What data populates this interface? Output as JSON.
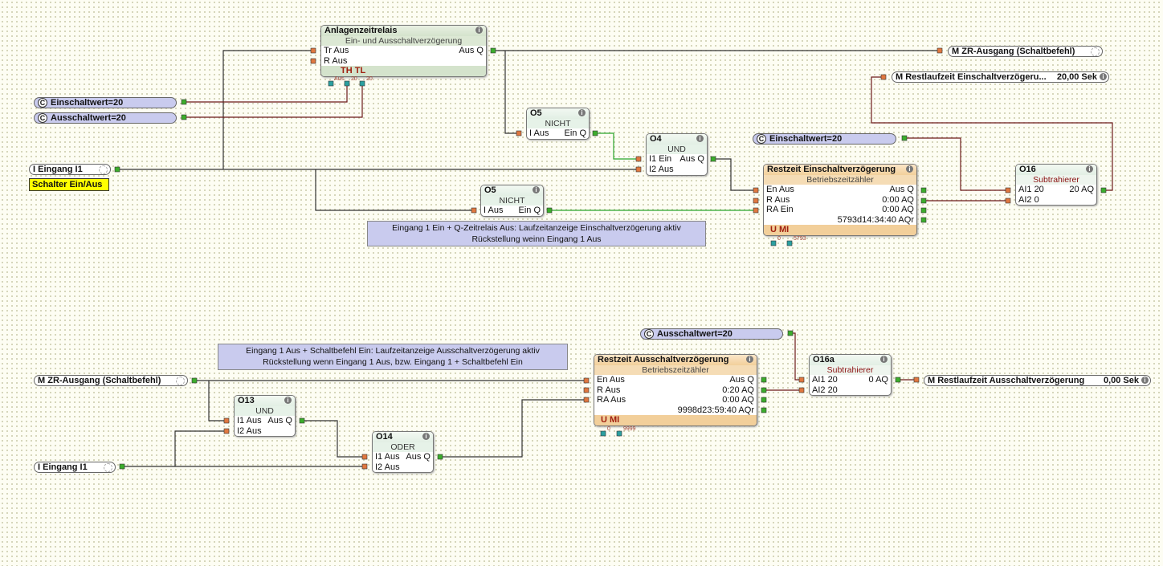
{
  "relay": {
    "title": "Anlagenzeitrelais",
    "subtitle": "Ein- und Ausschaltverzögerung",
    "in1": "Tr Aus",
    "in2": "R Aus",
    "out": "Aus Q",
    "footer": "TH  TL",
    "p1": "Aus",
    "p2": "20",
    "p3": "20"
  },
  "o5a": {
    "title": "O5",
    "subtitle": "NICHT",
    "in": "I Aus",
    "out": "Ein Q"
  },
  "o4": {
    "title": "O4",
    "subtitle": "UND",
    "in1": "I1 Ein",
    "out": "Aus Q",
    "in2": "I2 Aus"
  },
  "o5b": {
    "title": "O5",
    "subtitle": "NICHT",
    "in": "I Aus",
    "out": "Ein Q"
  },
  "rein": {
    "title": "Restzeit Einschaltverzögerung",
    "subtitle": "Betriebszeitzähler",
    "in1": "En Aus",
    "in2": "R Aus",
    "in3": "RA Ein",
    "out1": "Aus Q",
    "out2": "0:00 AQ",
    "out3": "0:00 AQ",
    "out4": "5793d14:34:40 AQr",
    "footer": "U  MI",
    "p1": "0",
    "p2": "5793"
  },
  "o16": {
    "title": "O16",
    "subtitle": "Subtrahierer",
    "in1": "AI1 20",
    "out": "20 AQ",
    "in2": "AI2 0"
  },
  "comment1": [
    "Eingang 1 Ein + Q-Zeitrelais Aus: Laufzeitanzeige Einschaltverzögerung aktiv",
    "Rückstellung weinn Eingang 1 Aus"
  ],
  "const_ein_top": "Einschaltwert=20",
  "const_ein": "Einschaltwert=20",
  "const_aus": "Ausschaltwert=20",
  "const_aus_bottom": "Ausschaltwert=20",
  "const_badge": "C",
  "input1": "I  Eingang I1",
  "input1b": "I  Eingang I1",
  "label_switch": "Schalter Ein/Aus",
  "out_zr": "M  ZR-Ausgang (Schaltbefehl)",
  "in_zr": "M  ZR-Ausgang (Schaltbefehl)",
  "out_rest_ein": {
    "name": "M  Restlaufzeit Einschaltverzögeru...",
    "value": "20,00 Sek"
  },
  "out_rest_aus": {
    "name": "M  Restlaufzeit Ausschaltverzögerung",
    "value": "0,00 Sek"
  },
  "comment2": [
    "Eingang 1 Aus + Schaltbefehl Ein: Laufzeitanzeige Ausschaltverzögerung aktiv",
    "Rückstellung wenn Eingang 1 Aus, bzw. Eingang 1 + Schaltbefehl Ein"
  ],
  "o13": {
    "title": "O13",
    "subtitle": "UND",
    "in1": "I1 Aus",
    "out": "Aus Q",
    "in2": "I2 Aus"
  },
  "o14": {
    "title": "O14",
    "subtitle": "ODER",
    "in1": "I1 Aus",
    "out": "Aus Q",
    "in2": "I2 Aus"
  },
  "raus": {
    "title": "Restzeit Ausschaltverzögerung",
    "subtitle": "Betriebszeitzähler",
    "in1": "En Aus",
    "in2": "R Aus",
    "in3": "RA Aus",
    "out1": "Aus Q",
    "out2": "0:20 AQ",
    "out3": "0:00 AQ",
    "out4": "9998d23:59:40 AQr",
    "footer": "U  MI",
    "p1": "0",
    "p2": "9999"
  },
  "o16a": {
    "title": "O16a",
    "subtitle": "Subtrahierer",
    "in1": "AI1 20",
    "out": "0 AQ",
    "in2": "AI2 20"
  },
  "info_glyph": "i",
  "colors": {
    "digital_wire": "#333333",
    "analog_wire": "#6b1a1a",
    "active_wire": "#2aa52a",
    "input_pin": "#e07840",
    "output_pin": "#3cad2c",
    "constant_fill": "#c9cbee",
    "comment_fill": "#c9cbee"
  }
}
